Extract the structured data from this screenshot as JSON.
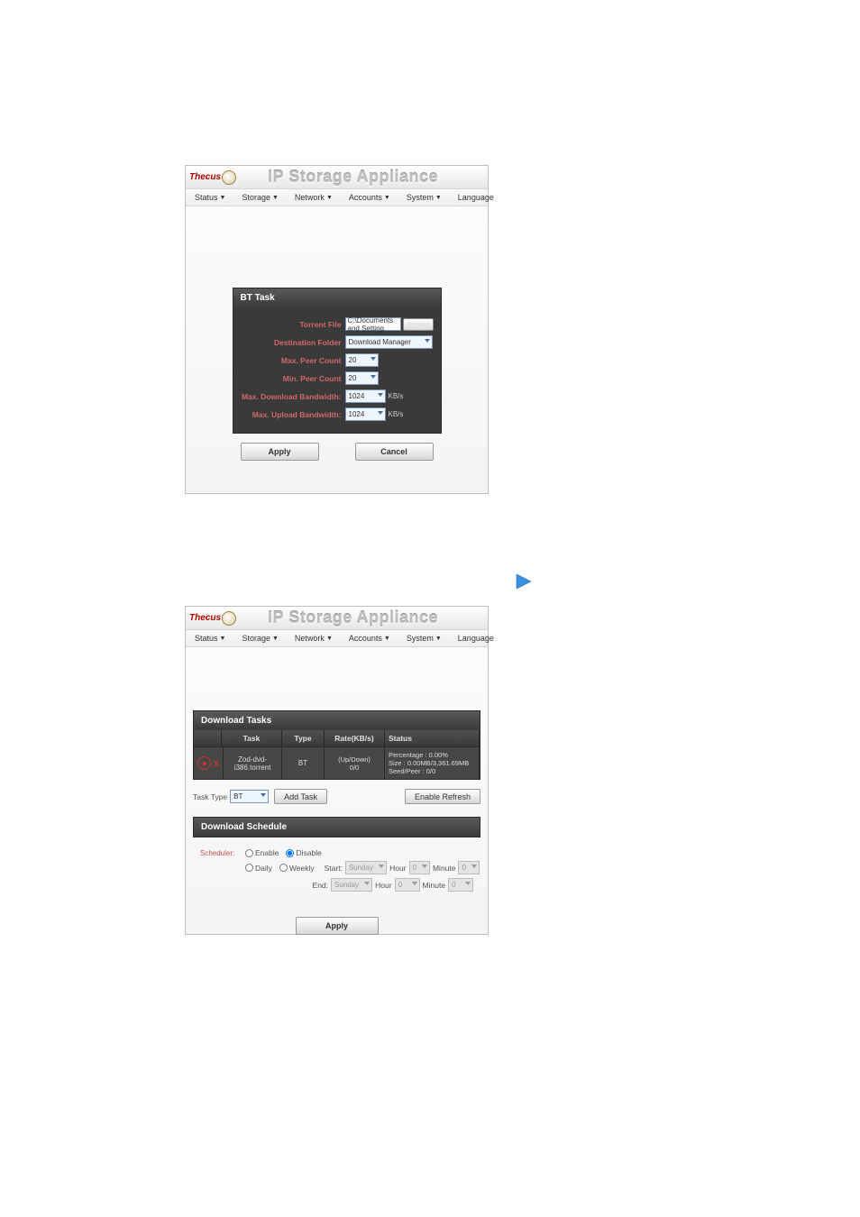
{
  "app": {
    "brand_left": "Thecus",
    "title": "IP Storage Appliance"
  },
  "menu": {
    "items": [
      "Status",
      "Storage",
      "Network",
      "Accounts",
      "System",
      "Language"
    ]
  },
  "bt": {
    "panel_title": "BT Task",
    "labels": {
      "torrent_file": "Torrent File",
      "dest_folder": "Destination Folder",
      "max_peer": "Max. Peer Count",
      "min_peer": "Min. Peer Count",
      "max_down_bw": "Max. Download Bandwidth:",
      "max_up_bw": "Max. Upload Bandwidth:"
    },
    "values": {
      "torrent_file": "C:\\Documents and Setting",
      "browse": "Browse",
      "dest_folder": "Download Manager",
      "max_peer": "20",
      "min_peer": "20",
      "max_down_bw": "1024",
      "max_up_bw": "1024",
      "unit": "KB/s"
    },
    "buttons": {
      "apply": "Apply",
      "cancel": "Cancel"
    }
  },
  "dl": {
    "tasks_title": "Download Tasks",
    "headers": {
      "task": "Task",
      "type": "Type",
      "rate": "Rate(KB/s)",
      "status": "Status"
    },
    "row": {
      "name": "Zod-dvd-i386.torrent",
      "type": "BT",
      "rate_top": "(Up/Down)",
      "rate_bot": "0/0",
      "status_l1": "Percentage : 0.00%",
      "status_l2": "Size : 0.00MB/3,361.69MB",
      "status_l3": "Seed/Peer : 0/0"
    },
    "ctrl": {
      "task_type_label": "Task Type",
      "task_type_value": "BT",
      "add_task": "Add Task",
      "enable_refresh": "Enable Refresh"
    },
    "sched": {
      "title": "Download Schedule",
      "scheduler_label": "Scheduler:",
      "enable": "Enable",
      "disable": "Disable",
      "daily": "Daily",
      "weekly": "Weekly",
      "start": "Start:",
      "end": "End:",
      "day": "Sunday",
      "hour_lbl": "Hour",
      "min_lbl": "Minute",
      "hour_val": "0",
      "min_val": "0"
    },
    "apply": "Apply"
  }
}
